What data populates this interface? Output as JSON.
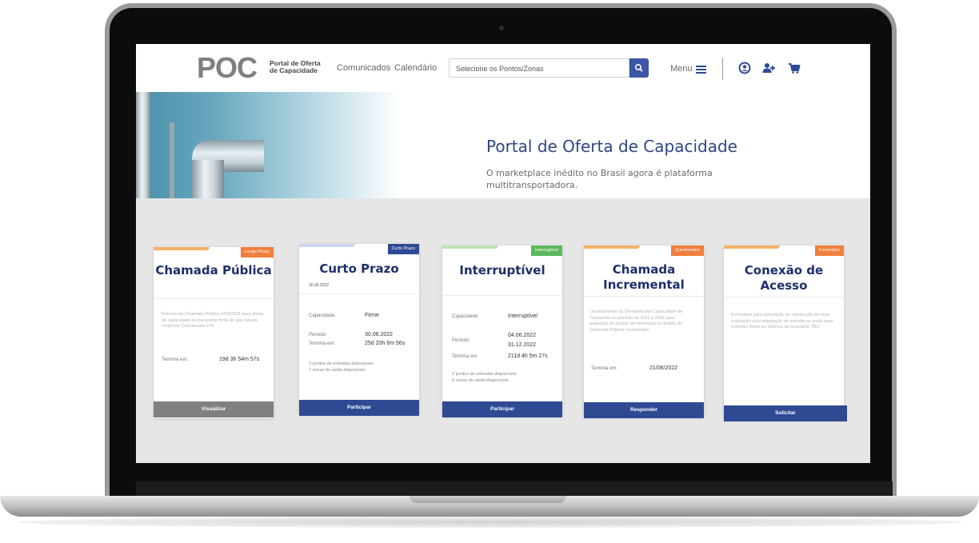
{
  "header": {
    "logo": "POC",
    "logo_subtitle": "Portal de Oferta de Capacidade",
    "nav_links": [
      "Comunicados",
      "Calendário"
    ],
    "search_placeholder": "Selecione os Pontos/Zonas",
    "menu_label": "Menu",
    "icons": [
      "search-icon",
      "hamburger-icon",
      "user-icon",
      "add-user-icon",
      "cart-icon"
    ]
  },
  "hero": {
    "title": "Portal de Oferta de Capacidade",
    "subtitle": "O marketplace inédito no Brasil agora é plataforma multitransportadora."
  },
  "colors": {
    "primary": "#2f4a93",
    "orange": "#f07f3c",
    "green": "#5cb85c",
    "gray_button": "#808080"
  },
  "cards": [
    {
      "badge": "Longo Prazo",
      "title": "Chamada Pública",
      "description": "Reinício da Chamada Pública nº03/2021 para oferta de capacidade de transporte firme de gás natural conforme Comunicado nº9",
      "ends_label": "Termina em:",
      "ends_value": "19d 3h 54m 57s",
      "button": "Visualizar"
    },
    {
      "badge": "Curto Prazo",
      "title": "Curto Prazo",
      "date": "30.06.2022",
      "capacity_label": "Capacidade:",
      "capacity_value": "Firme",
      "period_label": "Período:",
      "period_value": "30.06.2022",
      "ends_label": "Termina em:",
      "ends_value": "25d 20h 6m 56s",
      "note_1": "3 pontos de entradas disponíveis",
      "note_2": "7 zonas de saída disponíveis",
      "button": "Participar"
    },
    {
      "badge": "Interruptível",
      "title": "Interruptível",
      "capacity_label": "Capacidade:",
      "capacity_value": "Interruptível",
      "period_label": "Período:",
      "period_value_1": "04.06.2022",
      "period_value_2": "31.12.2022",
      "ends_label": "Termina em:",
      "ends_value": "211d 4h 5m 27s",
      "note_1": "2 pontos de entradas disponíveis",
      "note_2": "9 zonas de saída disponíveis",
      "button": "Participar"
    },
    {
      "badge": "Questionário",
      "title": "Chamada Incremental",
      "description": "Levantamento de Demanda por Capacidade de Transporte no período de 2023 a 2032 para avaliação do projeto de referência no âmbito da Chamada Pública Incremental",
      "ends_label": "Termina em:",
      "ends_value": "21/06/2022",
      "button": "Responder"
    },
    {
      "badge": "Formulário",
      "title": "Conexão de Acesso",
      "description": "Formulário para solicitação de construção de nova instalação e/ou adaptação de entrada ou saída para conexão direta ao Sistema de Gasoduto TBG",
      "button": "Solicitar"
    }
  ]
}
